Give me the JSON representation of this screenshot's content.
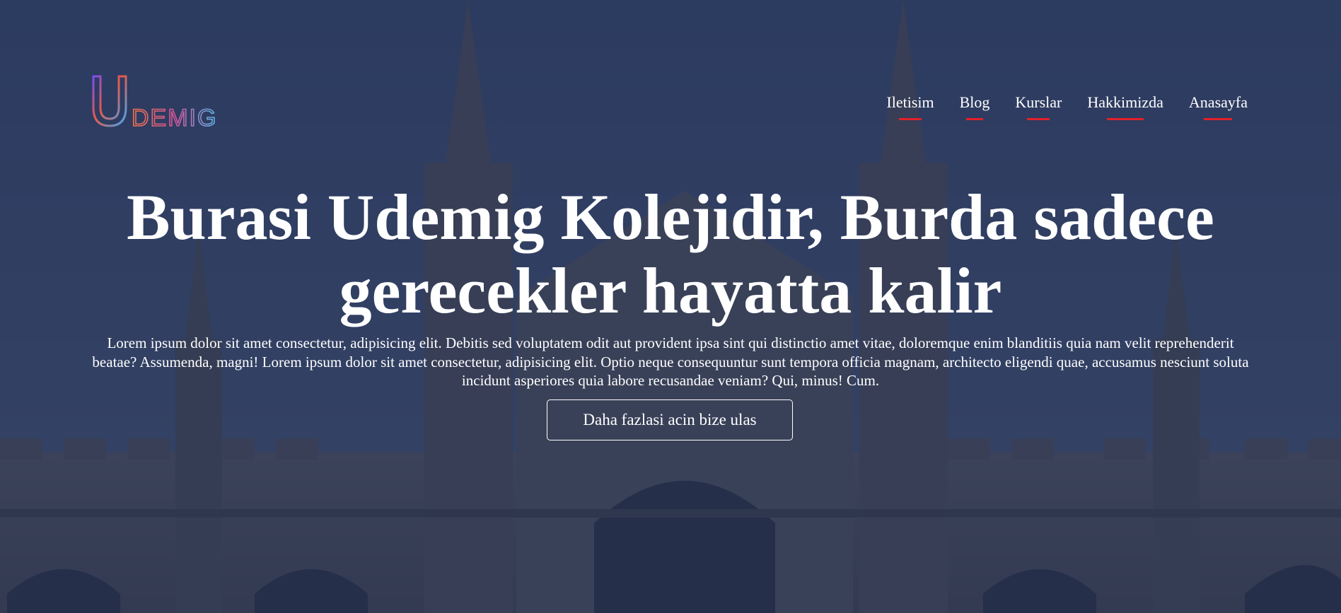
{
  "logo": {
    "initial": "U",
    "rest": "DEMIG"
  },
  "nav": {
    "items": [
      "Iletisim",
      "Blog",
      "Kurslar",
      "Hakkimizda",
      "Anasayfa"
    ]
  },
  "hero": {
    "headline": "Burasi Udemig Kolejidir, Burda sadece gerecekler hayatta kalir",
    "paragraph": "Lorem ipsum dolor sit amet consectetur, adipisicing elit. Debitis sed voluptatem odit aut provident ipsa sint qui distinctio amet vitae, doloremque enim blanditiis quia nam velit reprehenderit beatae? Assumenda, magni! Lorem ipsum dolor sit amet consectetur, adipisicing elit. Optio neque consequuntur sunt tempora officia magnam, architecto eligendi quae, accusamus nesciunt soluta incidunt asperiores quia labore recusandae veniam? Qui, minus! Cum.",
    "cta_label": "Daha fazlasi acin bize ulas"
  },
  "colors": {
    "overlay": "#1c284b",
    "accent_underline": "#e3202a",
    "text": "#ffffff"
  }
}
